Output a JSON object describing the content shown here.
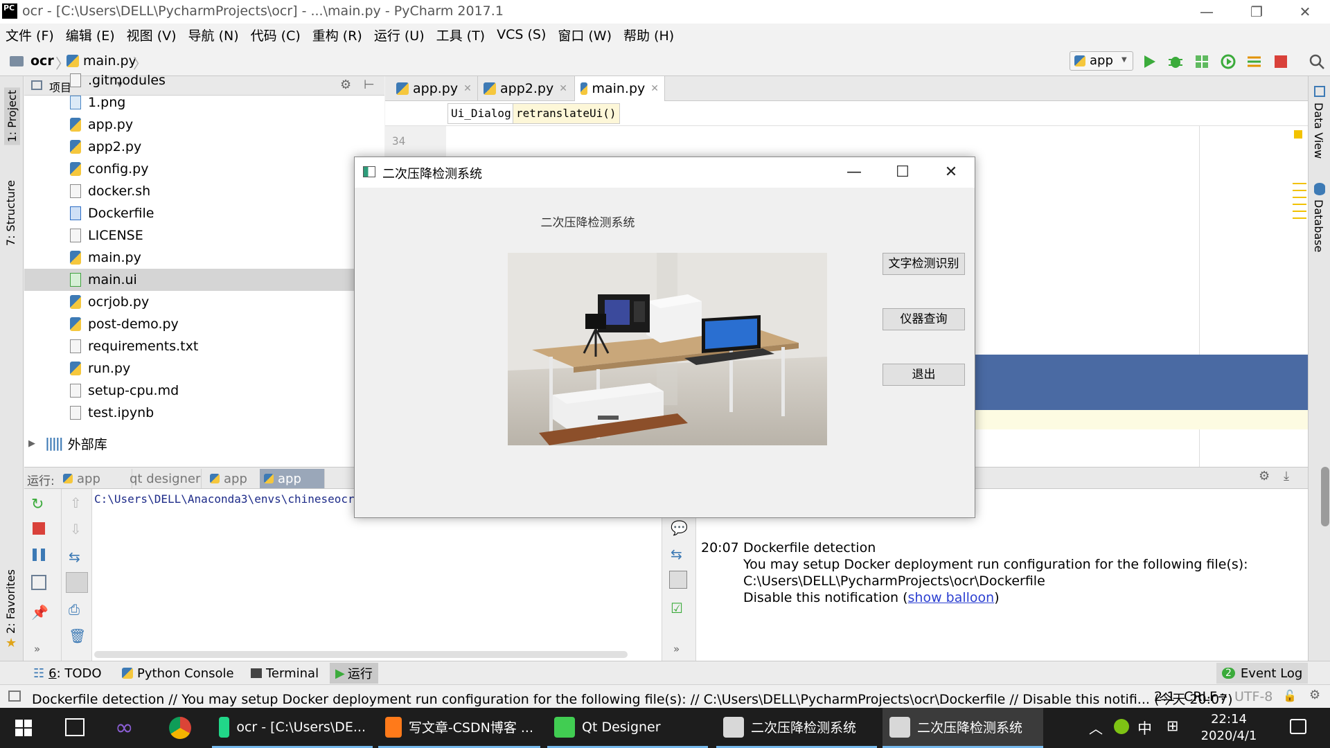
{
  "window": {
    "title": "ocr - [C:\\Users\\DELL\\PycharmProjects\\ocr] - ...\\main.py - PyCharm 2017.1"
  },
  "menu": [
    "文件 (F)",
    "编辑 (E)",
    "视图 (V)",
    "导航 (N)",
    "代码 (C)",
    "重构 (R)",
    "运行 (U)",
    "工具 (T)",
    "VCS (S)",
    "窗口 (W)",
    "帮助 (H)"
  ],
  "nav": {
    "project": "ocr",
    "file": "main.py",
    "run_config": "app"
  },
  "left_stripe": {
    "project": "1: Project",
    "structure": "7: Structure",
    "favorites": "2: Favorites"
  },
  "right_stripe": {
    "data_view": "Data View",
    "database": "Database"
  },
  "project_panel": {
    "title": "项目",
    "items": [
      {
        "name": ".gitmodules",
        "type": "text"
      },
      {
        "name": "1.png",
        "type": "img"
      },
      {
        "name": "app.py",
        "type": "py"
      },
      {
        "name": "app2.py",
        "type": "py"
      },
      {
        "name": "config.py",
        "type": "py"
      },
      {
        "name": "docker.sh",
        "type": "text"
      },
      {
        "name": "Dockerfile",
        "type": "docker"
      },
      {
        "name": "LICENSE",
        "type": "text"
      },
      {
        "name": "main.py",
        "type": "py"
      },
      {
        "name": "main.ui",
        "type": "ui"
      },
      {
        "name": "ocrjob.py",
        "type": "py"
      },
      {
        "name": "post-demo.py",
        "type": "py"
      },
      {
        "name": "requirements.txt",
        "type": "text"
      },
      {
        "name": "run.py",
        "type": "py"
      },
      {
        "name": "setup-cpu.md",
        "type": "text"
      },
      {
        "name": "test.ipynb",
        "type": "text"
      }
    ],
    "selected_index": 9,
    "external_libs": "外部库"
  },
  "editor": {
    "tabs": [
      {
        "label": "app.py",
        "active": false
      },
      {
        "label": "app2.py",
        "active": false
      },
      {
        "label": "main.py",
        "active": true
      }
    ],
    "breadcrumbs": [
      "Ui_Dialog",
      "retranslateUi()"
    ],
    "line_number": "34"
  },
  "run_panel": {
    "label": "运行:",
    "tabs": [
      {
        "label": "app",
        "active": false
      },
      {
        "label": "qt designer",
        "active": false
      },
      {
        "label": "app",
        "active": false
      },
      {
        "label": "app",
        "active": true
      }
    ],
    "console_line": "C:\\Users\\DELL\\Anaconda3\\envs\\chineseocr\\py"
  },
  "event_log": {
    "time": "20:07",
    "title": "Dockerfile detection",
    "line1": "You may setup Docker deployment run configuration for the following file(s):",
    "line2": "C:\\Users\\DELL\\PycharmProjects\\ocr\\Dockerfile",
    "line3_prefix": "Disable this notification (",
    "line3_link": "show balloon",
    "line3_suffix": ")"
  },
  "tool_windows": {
    "todo_num": "6",
    "todo": ": TODO",
    "python_console": "Python Console",
    "terminal": "Terminal",
    "run": "运行",
    "event_log_count": "2",
    "event_log": "Event Log"
  },
  "status": {
    "message": "Dockerfile detection // You may setup Docker deployment run configuration for the following file(s): // C:\\Users\\DELL\\PycharmProjects\\ocr\\Dockerfile // Disable this notifi... (今天 20:07)",
    "position": "2:1",
    "line_sep": "CRLF÷",
    "encoding": "UTF-8"
  },
  "dialog": {
    "title": "二次压降检测系统",
    "heading": "二次压降检测系统",
    "buttons": [
      "文字检测识别",
      "仪器查询",
      "退出"
    ]
  },
  "taskbar": {
    "apps": [
      {
        "label": "ocr - [C:\\Users\\DE...",
        "icon": "pycharm-icon",
        "color": "#21d789"
      },
      {
        "label": "写文章-CSDN博客 ...",
        "icon": "firefox-icon",
        "color": "#ff7a1a"
      },
      {
        "label": "Qt Designer",
        "icon": "qt-icon",
        "color": "#41cd52"
      },
      {
        "label": "二次压降检测系统",
        "icon": "dialog-icon",
        "color": "#d8d8d8"
      },
      {
        "label": "二次压降检测系统",
        "icon": "dialog-icon",
        "color": "#d8d8d8"
      }
    ],
    "ime_lang": "中",
    "time": "22:14",
    "date": "2020/4/1"
  }
}
